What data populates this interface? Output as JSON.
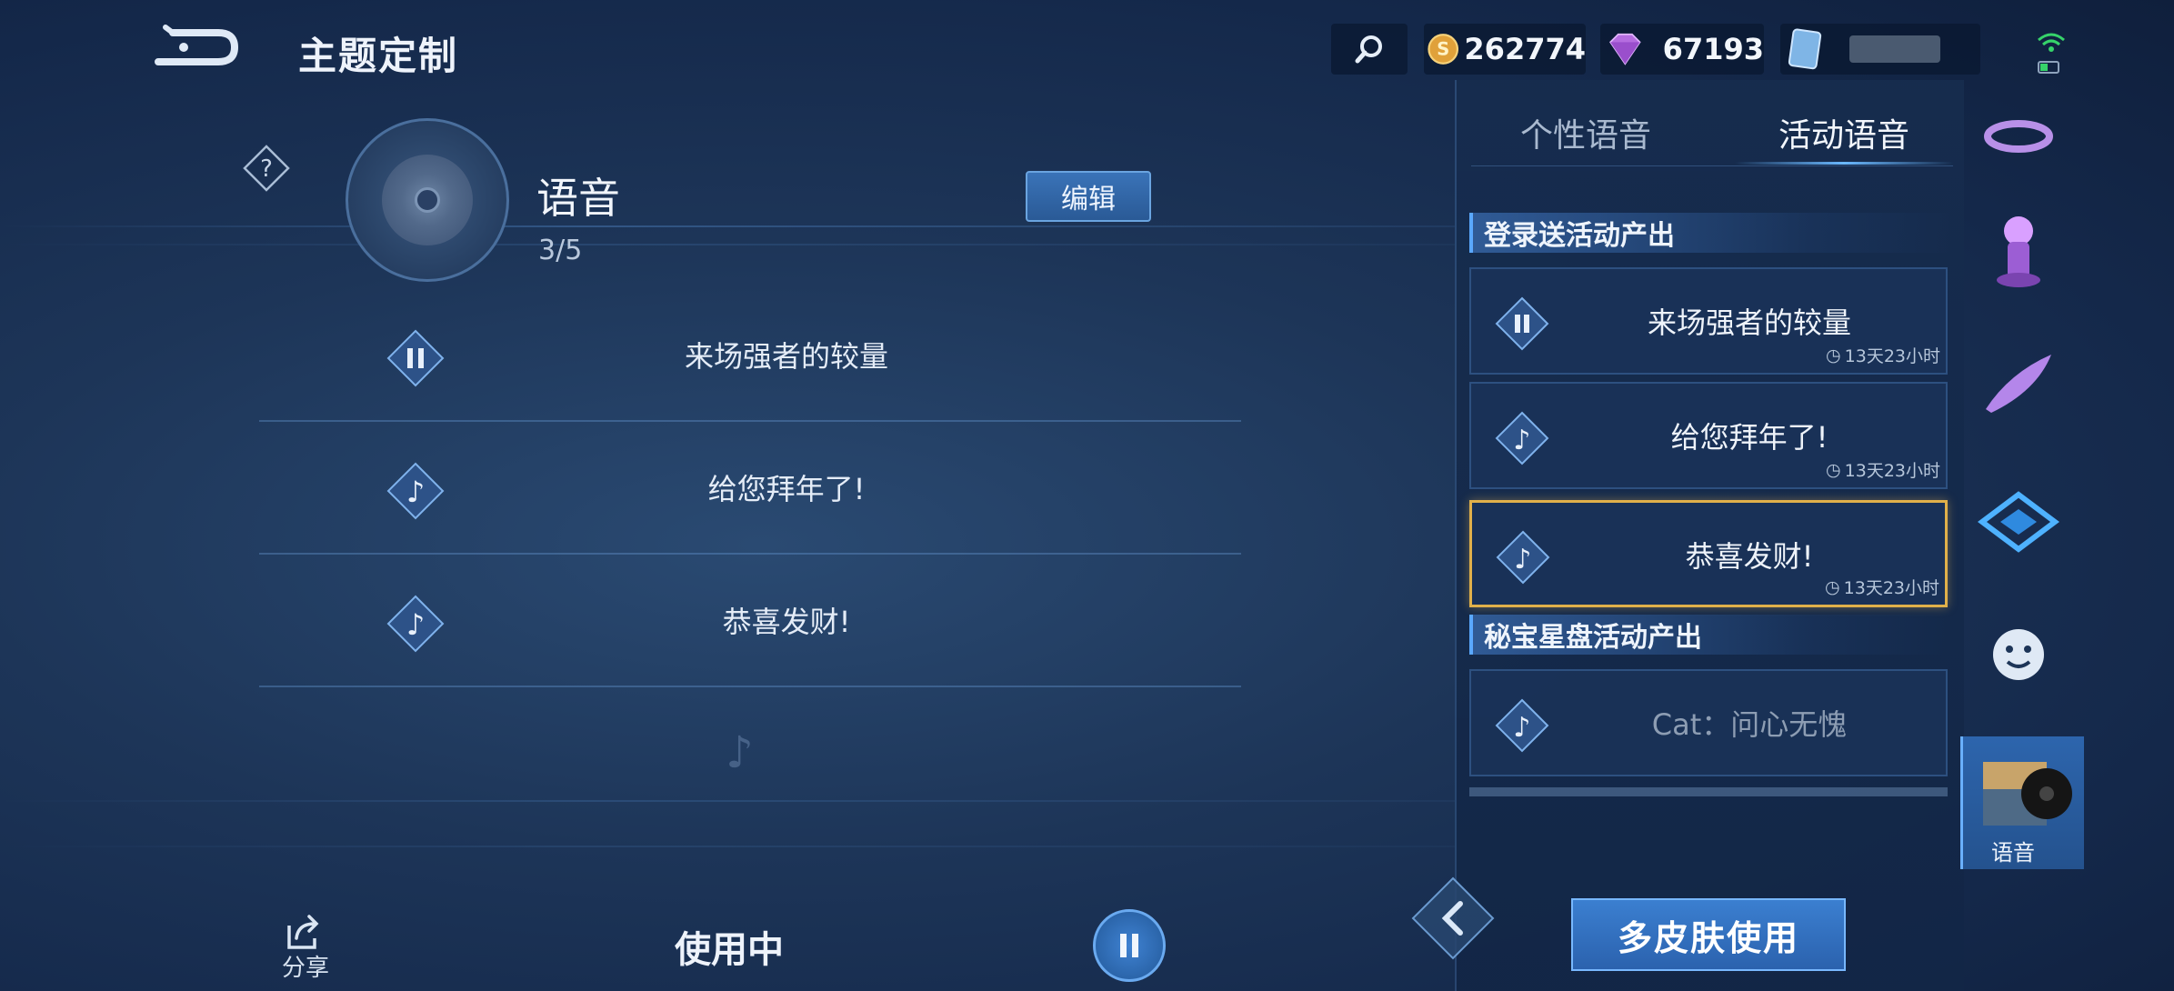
{
  "header": {
    "title": "主题定制",
    "gold": "262774",
    "diamond": "67193"
  },
  "voice_panel": {
    "title": "语音",
    "count": "3/5",
    "edit_label": "编辑",
    "rows": [
      {
        "label": "来场强者的较量",
        "state": "pause"
      },
      {
        "label": "给您拜年了!",
        "state": "note"
      },
      {
        "label": "恭喜发财!",
        "state": "note"
      }
    ]
  },
  "footer": {
    "share_label": "分享",
    "in_use_label": "使用中",
    "multi_skin_label": "多皮肤使用"
  },
  "tabs": {
    "personal": "个性语音",
    "event": "活动语音"
  },
  "sections": {
    "login": "登录送活动产出",
    "star": "秘宝星盘活动产出"
  },
  "cards": [
    {
      "label": "来场强者的较量",
      "time": "13天23小时"
    },
    {
      "label": "给您拜年了!",
      "time": "13天23小时"
    },
    {
      "label": "恭喜发财!",
      "time": "13天23小时"
    },
    {
      "label": "Cat：问心无愧"
    }
  ],
  "rail": {
    "active_label": "语音"
  },
  "colors": {
    "accent_blue": "#3b7fd0",
    "selected_gold": "#e0b04a",
    "bg_dark": "#14284a"
  }
}
